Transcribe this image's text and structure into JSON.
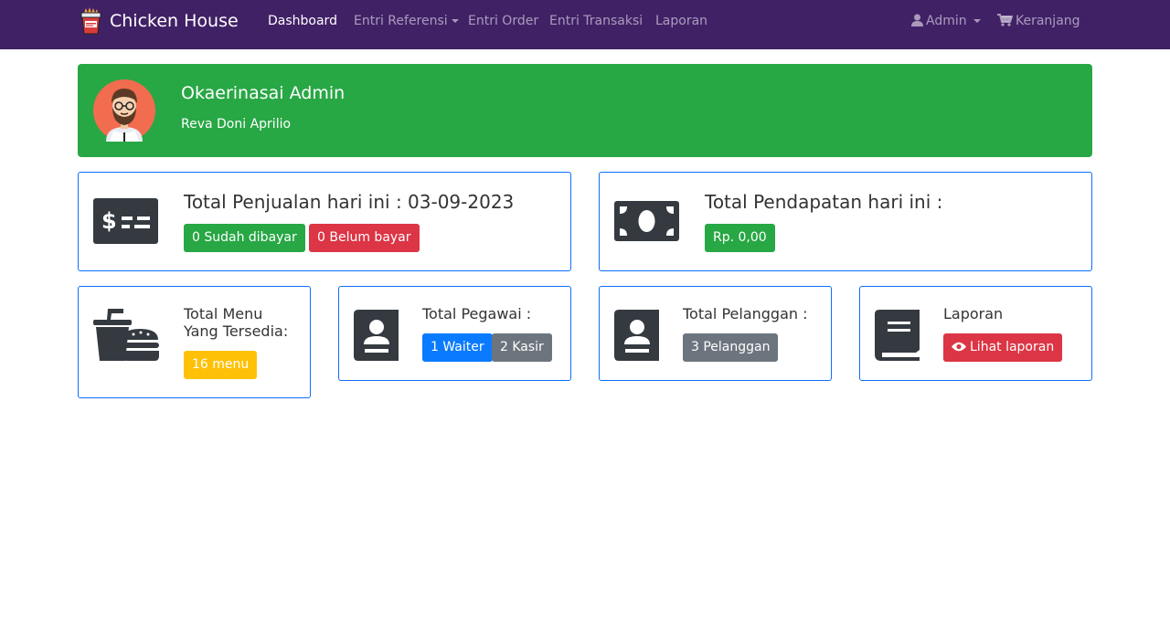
{
  "navbar": {
    "brand": "Chicken House",
    "items": [
      {
        "label": "Dashboard"
      },
      {
        "label": "Entri Referensi"
      },
      {
        "label": "Entri Order"
      },
      {
        "label": "Entri Transaksi"
      },
      {
        "label": "Laporan"
      }
    ],
    "user_menu": "Admin",
    "cart": "Keranjang"
  },
  "welcome": {
    "title": "Okaerinasai Admin",
    "subtitle": "Reva Doni Aprilio"
  },
  "sales_card": {
    "title": "Total Penjualan hari ini : 03-09-2023",
    "paid_badge": "0 Sudah dibayar",
    "unpaid_badge": "0 Belum bayar"
  },
  "income_card": {
    "title": "Total Pendapatan hari ini :",
    "amount_badge": "Rp. 0,00"
  },
  "menu_card": {
    "title_line1": "Total Menu",
    "title_line2": "Yang Tersedia:",
    "badge": "16 menu"
  },
  "employee_card": {
    "title": "Total Pegawai :",
    "waiter_badge": "1 Waiter",
    "cashier_badge": "2 Kasir"
  },
  "customer_card": {
    "title": "Total Pelanggan :",
    "badge": "3 Pelanggan"
  },
  "report_card": {
    "title": "Laporan",
    "button": "Lihat laporan"
  },
  "colors": {
    "navbar": "#402166",
    "success": "#28a745",
    "danger": "#dc3545",
    "warning": "#ffc107",
    "primary": "#0a7bff",
    "secondary": "#6c757d",
    "card_border": "#0d6efd"
  }
}
